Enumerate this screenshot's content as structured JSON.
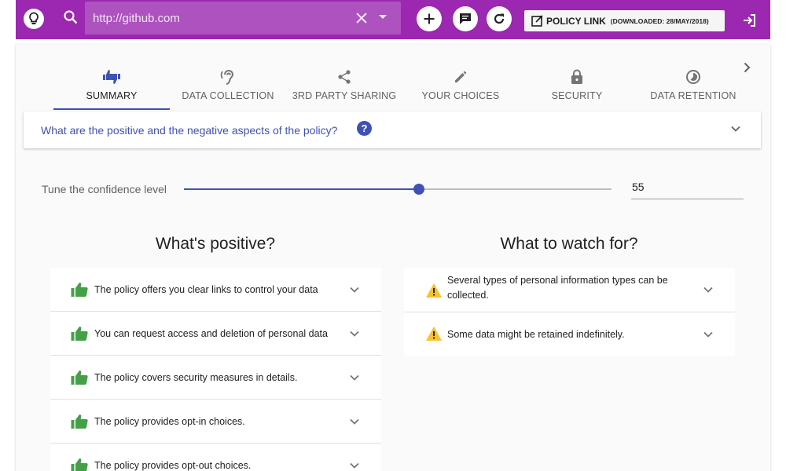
{
  "toolbar": {
    "url_value": "http://github.com",
    "policy_link_label": "POLICY LINK",
    "downloaded_label": "(DOWNLOADED: 28/MAY/2018)"
  },
  "tabs": [
    {
      "label": "SUMMARY",
      "icon": "thumbs-up-down-icon",
      "active": true
    },
    {
      "label": "DATA COLLECTION",
      "icon": "hearing-icon",
      "active": false
    },
    {
      "label": "3RD PARTY SHARING",
      "icon": "share-icon",
      "active": false
    },
    {
      "label": "YOUR CHOICES",
      "icon": "pencil-icon",
      "active": false
    },
    {
      "label": "SECURITY",
      "icon": "lock-icon",
      "active": false
    },
    {
      "label": "DATA RETENTION",
      "icon": "timelapse-icon",
      "active": false
    }
  ],
  "question": {
    "text": "What are the positive and the negative aspects of the policy?",
    "help_symbol": "?"
  },
  "confidence": {
    "label": "Tune the confidence level",
    "value": "55",
    "fraction": 0.55
  },
  "positive": {
    "title": "What's positive?",
    "items": [
      "The policy offers you clear links to control your data",
      "You can request access and deletion of personal data",
      "The policy covers security measures in details.",
      "The policy provides opt-in choices.",
      "The policy provides opt-out choices."
    ]
  },
  "negative": {
    "title": "What to watch for?",
    "items": [
      "Several types of personal information types can be collected.",
      "Some data might be retained indefinitely."
    ]
  },
  "colors": {
    "toolbar": "#9c27b0",
    "accent": "#3f51b5",
    "positive_icon": "#43a047",
    "warning_icon": "#fbc02d"
  }
}
